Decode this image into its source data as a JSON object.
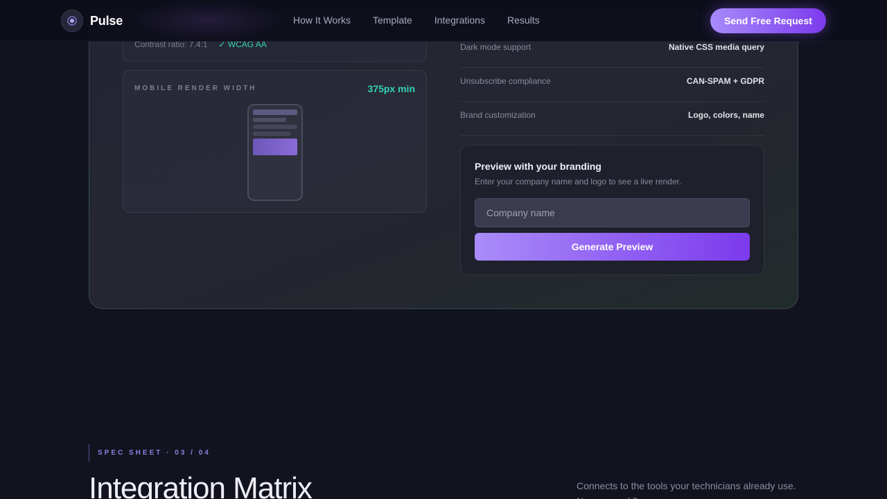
{
  "nav": {
    "brand": "Pulse",
    "links": [
      "How It Works",
      "Template",
      "Integrations",
      "Results"
    ],
    "cta": "Send Free Request"
  },
  "contrast": {
    "label": "Contrast ratio: 7.4:1",
    "badge": "✓ WCAG AA"
  },
  "mobile": {
    "label": "MOBILE RENDER WIDTH",
    "value": "375px min"
  },
  "specs": [
    {
      "key": "Dark mode support",
      "value": "Native CSS media query"
    },
    {
      "key": "Unsubscribe compliance",
      "value": "CAN-SPAM + GDPR"
    },
    {
      "key": "Brand customization",
      "value": "Logo, colors, name"
    }
  ],
  "preview": {
    "title": "Preview with your branding",
    "subtitle": "Enter your company name and logo to see a live render.",
    "input_placeholder": "Company name",
    "button": "Generate Preview"
  },
  "section": {
    "eyebrow": "SPEC SHEET · 03 / 04",
    "title": "Integration Matrix",
    "description": "Connects to the tools your technicians already use. No new workflows."
  },
  "colors": {
    "accent": "#8b5cf6",
    "teal": "#34d3b6",
    "background": "#12131f"
  }
}
